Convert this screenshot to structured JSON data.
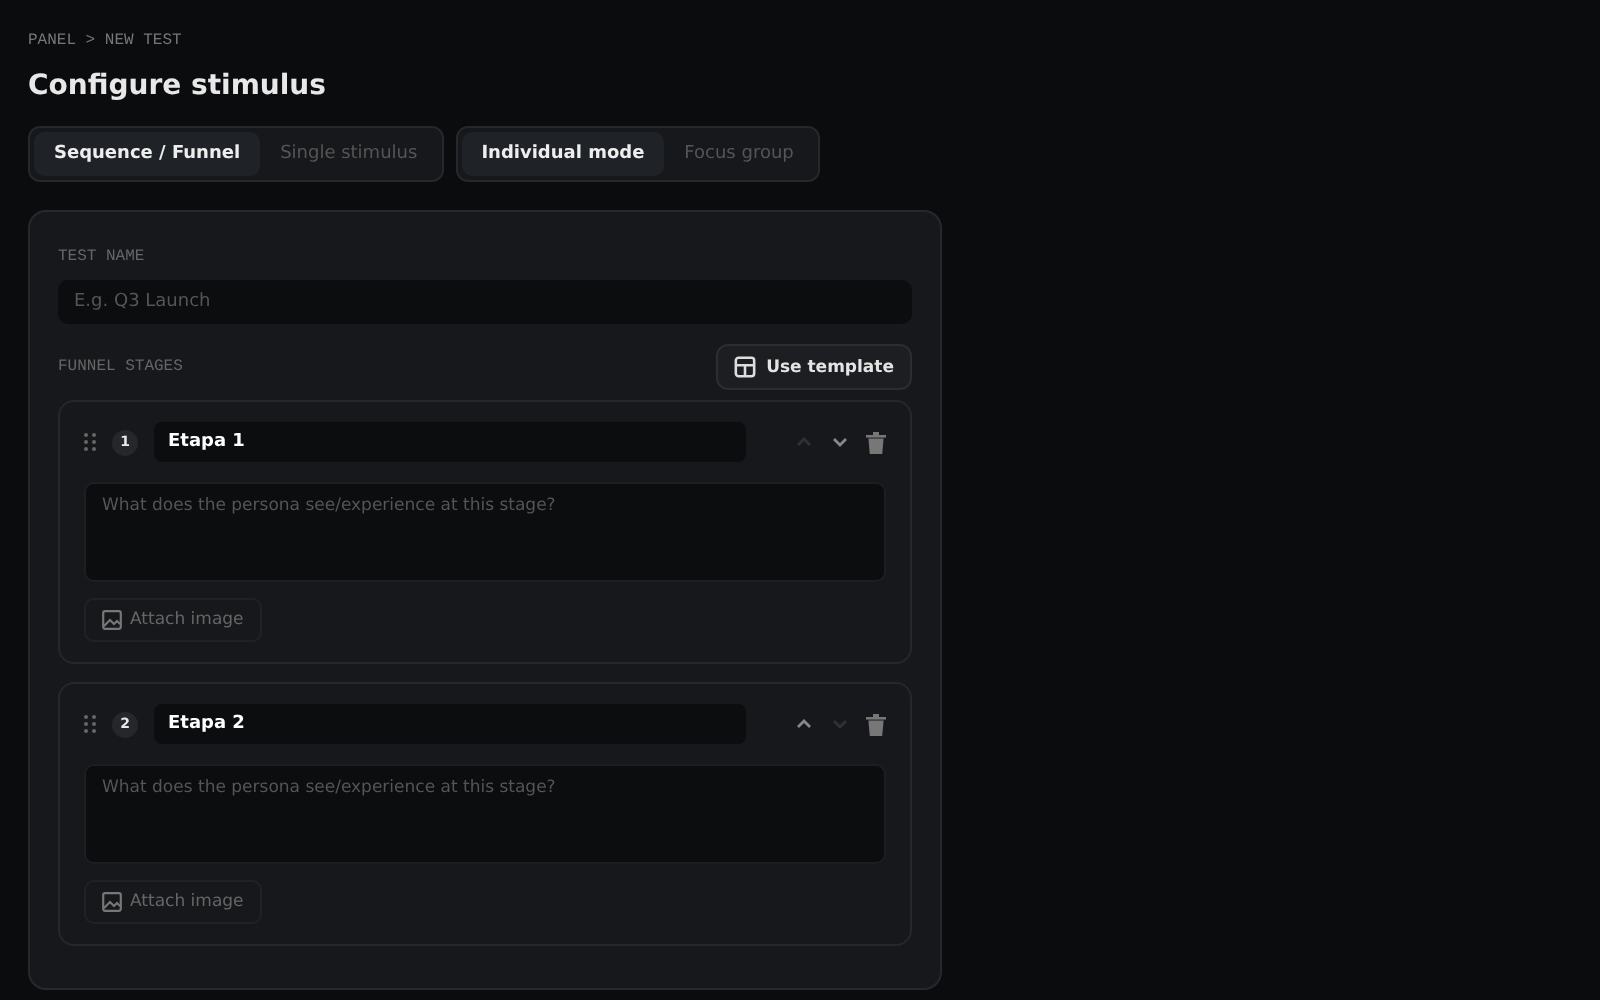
{
  "breadcrumb": "PANEL > NEW TEST",
  "title": "Configure stimulus",
  "toggle_groups": [
    {
      "options": [
        {
          "label": "Sequence / Funnel",
          "selected": true
        },
        {
          "label": "Single stimulus",
          "selected": false
        }
      ]
    },
    {
      "options": [
        {
          "label": "Individual mode",
          "selected": true
        },
        {
          "label": "Focus group",
          "selected": false
        }
      ]
    }
  ],
  "test_name": {
    "label": "TEST NAME",
    "placeholder": "E.g. Q3 Launch"
  },
  "funnel": {
    "label": "FUNNEL STAGES",
    "template_button": "Use template",
    "stages": [
      {
        "number": "1",
        "name": "Etapa 1",
        "description_placeholder": "What does the persona see/experience at this stage?",
        "attach": "Attach image",
        "up_disabled": true,
        "down_disabled": false
      },
      {
        "number": "2",
        "name": "Etapa 2",
        "description_placeholder": "What does the persona see/experience at this stage?",
        "attach": "Attach image",
        "up_disabled": false,
        "down_disabled": true
      }
    ]
  }
}
